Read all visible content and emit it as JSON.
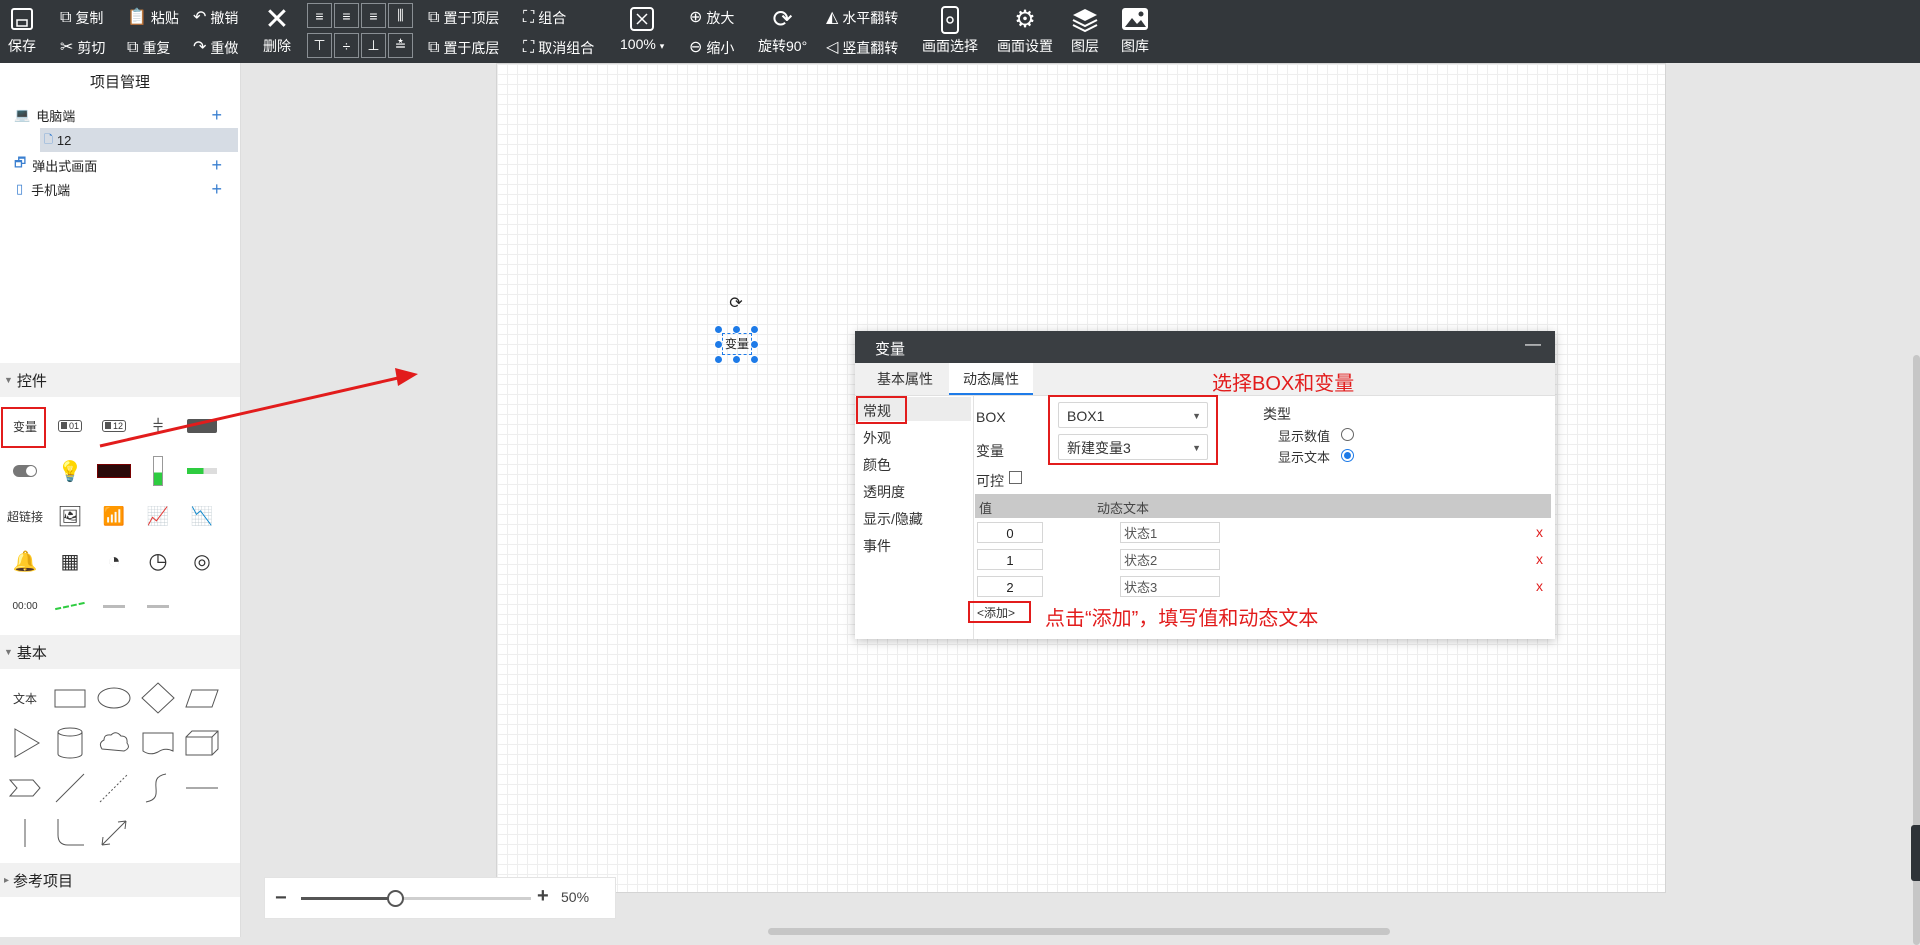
{
  "toolbar": {
    "save": "保存",
    "copy": "复制",
    "paste": "粘贴",
    "undo": "撤销",
    "cut": "剪切",
    "duplicate": "重复",
    "redo": "重做",
    "delete": "删除",
    "bring_front": "置于顶层",
    "send_back": "置于底层",
    "group": "组合",
    "ungroup": "取消组合",
    "zoom_value": "100%",
    "zoom_in": "放大",
    "zoom_out": "缩小",
    "rotate": "旋转90°",
    "flip_h": "水平翻转",
    "flip_v": "竖直翻转",
    "screen_select": "画面选择",
    "screen_settings": "画面设置",
    "layers": "图层",
    "gallery": "图库"
  },
  "project": {
    "title": "项目管理",
    "items": [
      {
        "label": "电脑端",
        "icon": "laptop-icon"
      },
      {
        "label": "12",
        "icon": "page-icon"
      },
      {
        "label": "弹出式画面",
        "icon": "popup-icon"
      },
      {
        "label": "手机端",
        "icon": "phone-icon"
      }
    ]
  },
  "controls": {
    "title": "控件",
    "variable": "变量",
    "num1": "01",
    "num2": "12",
    "hyperlink": "超链接",
    "clock": "00:00"
  },
  "basic": {
    "title": "基本",
    "text": "文本"
  },
  "reference": {
    "title": "参考项目"
  },
  "zoom": {
    "percent": "50%",
    "level": 0.5
  },
  "canvas_element": {
    "label": "变量"
  },
  "dialog": {
    "title": "变量",
    "minimize": "—",
    "tabs": [
      "基本属性",
      "动态属性"
    ],
    "active_tab": 1,
    "nav": [
      "常规",
      "外观",
      "颜色",
      "透明度",
      "显示/隐藏",
      "事件"
    ],
    "box_label": "BOX",
    "box_value": "BOX1",
    "var_label": "变量",
    "var_value": "新建变量3",
    "controllable_label": "可控",
    "type_label": "类型",
    "show_value": "显示数值",
    "show_text": "显示文本",
    "selected_type": "显示文本",
    "col_value": "值",
    "col_text": "动态文本",
    "rows": [
      {
        "value": "0",
        "text": "状态1"
      },
      {
        "value": "1",
        "text": "状态2"
      },
      {
        "value": "2",
        "text": "状态3"
      }
    ],
    "delete_mark": "x",
    "add_link": "<添加>"
  },
  "annotations": {
    "select_hint": "选择BOX和变量",
    "add_hint": "点击“添加”，填写值和动态文本"
  },
  "colors": {
    "toolbar_bg": "#33373b",
    "annotation_red": "#e21c1c",
    "accent_blue": "#1e7be8"
  }
}
